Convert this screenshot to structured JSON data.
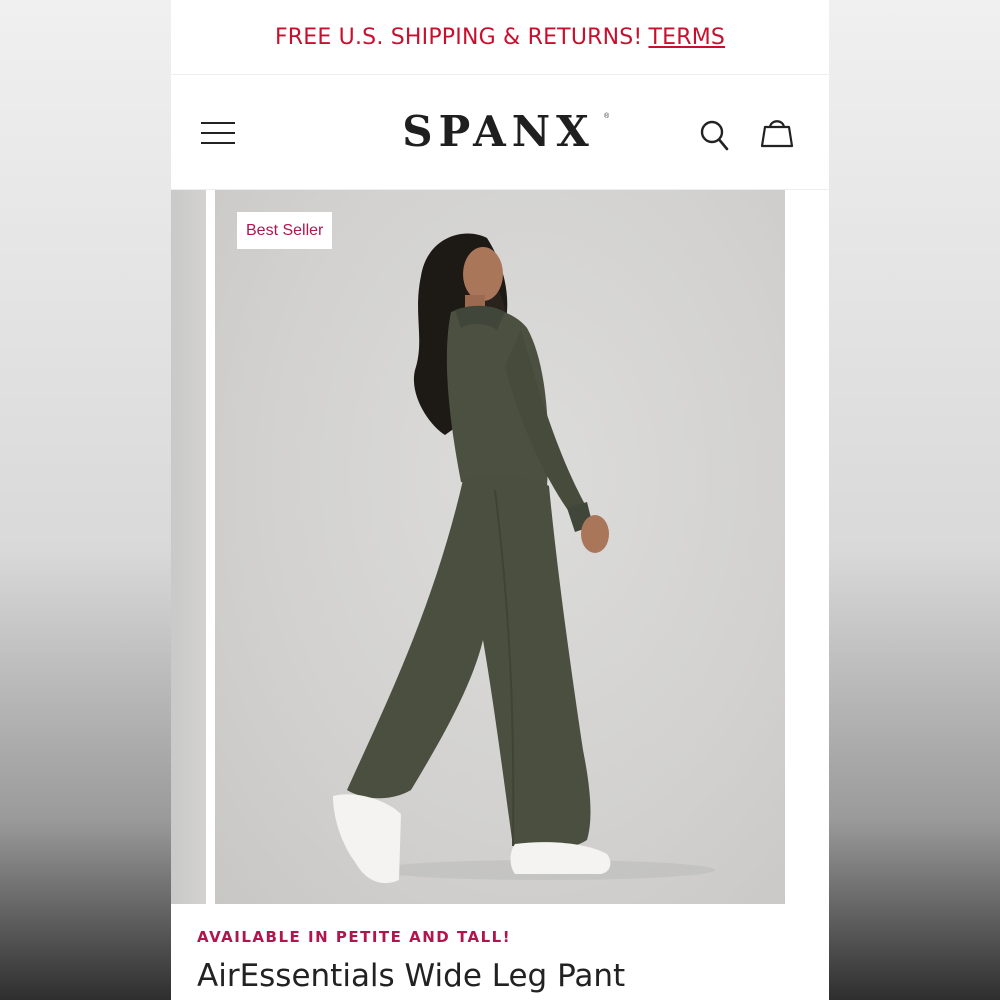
{
  "promo": {
    "text": "FREE U.S. SHIPPING & RETURNS!",
    "link_label": "TERMS"
  },
  "header": {
    "logo_text": "SPANX",
    "logo_mark": "®",
    "icons": [
      "menu-icon",
      "search-icon",
      "shopping-bag-icon"
    ]
  },
  "gallery": {
    "badge": "Best Seller"
  },
  "product": {
    "availability": "AVAILABLE IN PETITE AND TALL!",
    "name": "AirEssentials Wide Leg Pant"
  },
  "colors": {
    "accent_red": "#c8102e",
    "accent_berry": "#b0164e",
    "garment_olive": "#4b5040"
  }
}
